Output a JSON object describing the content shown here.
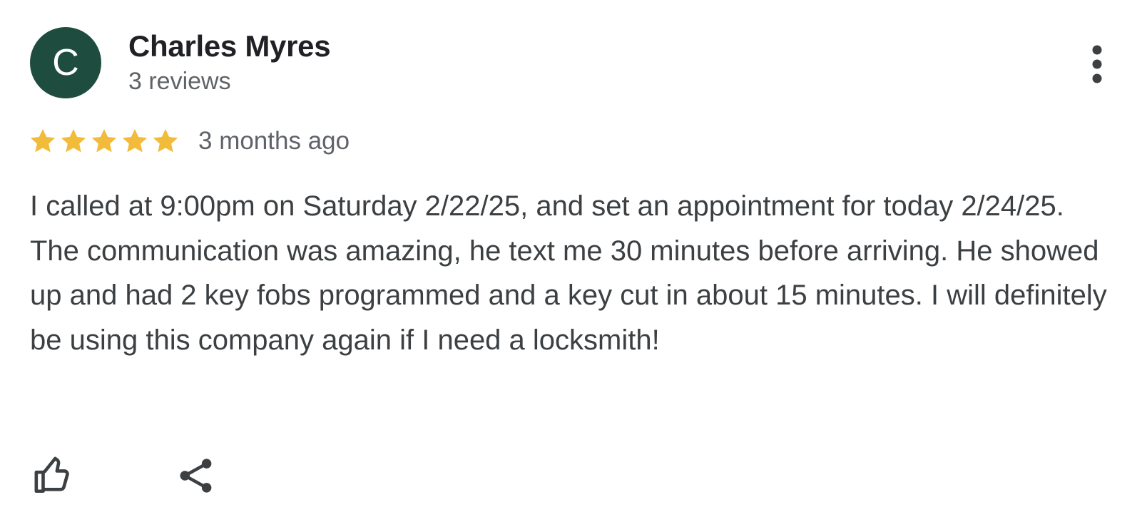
{
  "review": {
    "author": {
      "initial": "C",
      "name": "Charles Myres",
      "review_count": "3 reviews",
      "avatar_color": "#1e4d40"
    },
    "rating": 5,
    "max_rating": 5,
    "star_color": "#f2bb3a",
    "time_ago": "3 months ago",
    "text": "I called at 9:00pm on Saturday 2/22/25, and set an appointment for today 2/24/25. The communication was amazing, he text me 30 minutes before arriving. He showed up and had 2 key fobs programmed and a key cut in about 15 minutes. I will definitely be using this company again if I need a locksmith!"
  },
  "icons": {
    "more": "more-vert-icon",
    "star": "star-icon",
    "like": "thumbs-up-icon",
    "share": "share-icon"
  }
}
